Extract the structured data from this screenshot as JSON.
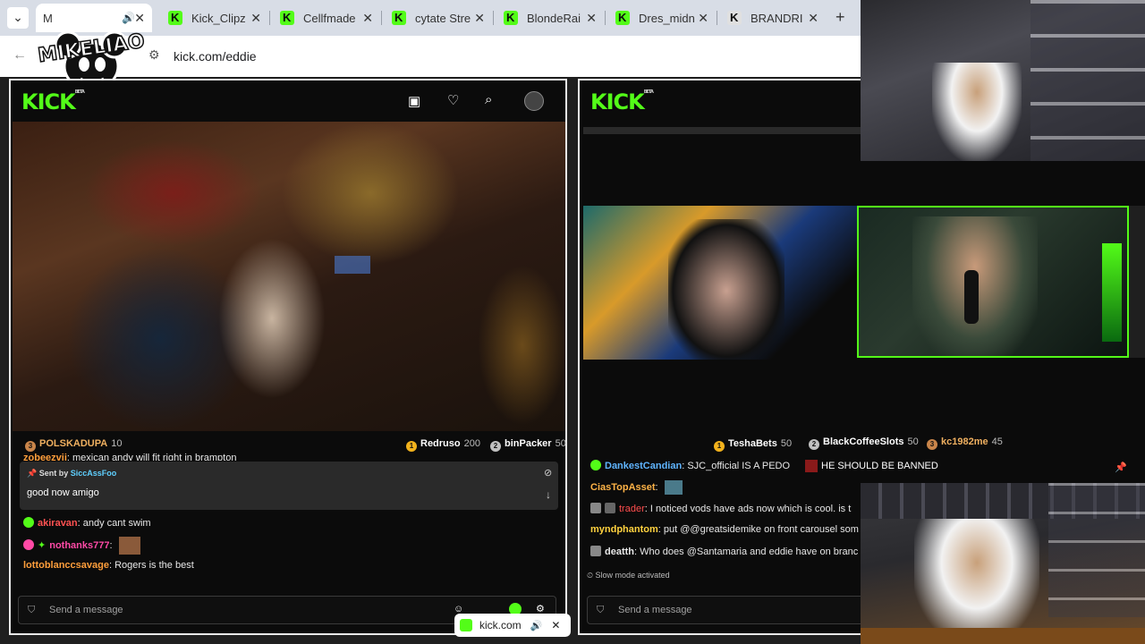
{
  "browser": {
    "tabs": [
      {
        "title": "M"
      },
      {
        "title": "Kick_Clipz"
      },
      {
        "title": "Cellfmade"
      },
      {
        "title": "cytate Stre"
      },
      {
        "title": "BlondeRai"
      },
      {
        "title": "Dres_midn"
      },
      {
        "title": "BRANDRI"
      }
    ],
    "url": "kick.com/eddie",
    "new_tab_label": "+",
    "menu_label": "⌄"
  },
  "overlay": {
    "logo_text": "MIKELIAO",
    "mini_player_url": "kick.com"
  },
  "left": {
    "logo": "KICK",
    "leaderboard": [
      {
        "rank": "3",
        "name": "POLSKADUPA",
        "count": "10",
        "color": "#c9854a"
      },
      {
        "rank": "1",
        "name": "Redruso",
        "count": "200",
        "color": "#f2b21c"
      },
      {
        "rank": "2",
        "name": "binPacker",
        "count": "50",
        "color": "#c0c0c0"
      }
    ],
    "cutoff_line": {
      "user": "zobeezvii",
      "text": ": mexican andy will fit right in brampton"
    },
    "pinned": {
      "prefix": "Sent by",
      "user": "SiccAssFoo",
      "message": "good now amigo"
    },
    "messages": [
      {
        "user": "akiravan",
        "user_color": "#ff5252",
        "text": ": andy cant swim"
      },
      {
        "user": "nothanks777",
        "user_color": "#ff4aa6",
        "text": ":"
      },
      {
        "user": "lottoblanccsavage",
        "user_color": "#ff9e3b",
        "text": ": Rogers is the best"
      }
    ],
    "input_placeholder": "Send a message"
  },
  "right": {
    "logo": "KICK",
    "leaderboard": [
      {
        "rank": "1",
        "name": "TeshaBets",
        "count": "50",
        "color": "#f2b21c"
      },
      {
        "rank": "2",
        "name": "BlackCoffeeSlots",
        "count": "50",
        "color": "#c0c0c0"
      },
      {
        "rank": "3",
        "name": "kc1982me",
        "count": "45",
        "color": "#c9854a"
      }
    ],
    "messages": [
      {
        "user": "DankestCandian",
        "user_color": "#5fb4ff",
        "text": ": SJC_official IS A PEDO",
        "extra": "HE SHOULD BE BANNED"
      },
      {
        "user": "CiasTopAsset",
        "user_color": "#ffb347",
        "text": ":"
      },
      {
        "user": "trader",
        "user_color": "#ff4d4d",
        "text": ": I noticed vods have ads now which is cool. is t"
      },
      {
        "user": "myndphantom",
        "user_color": "#ffd23f",
        "text": ": put @@greatsidemike on front carousel som"
      },
      {
        "user": "deatth",
        "user_color": "#e8e8e8",
        "text": ": Who does @Santamaria and eddie have on branc"
      }
    ],
    "slow_mode": "Slow mode activated",
    "input_placeholder": "Send a message"
  }
}
